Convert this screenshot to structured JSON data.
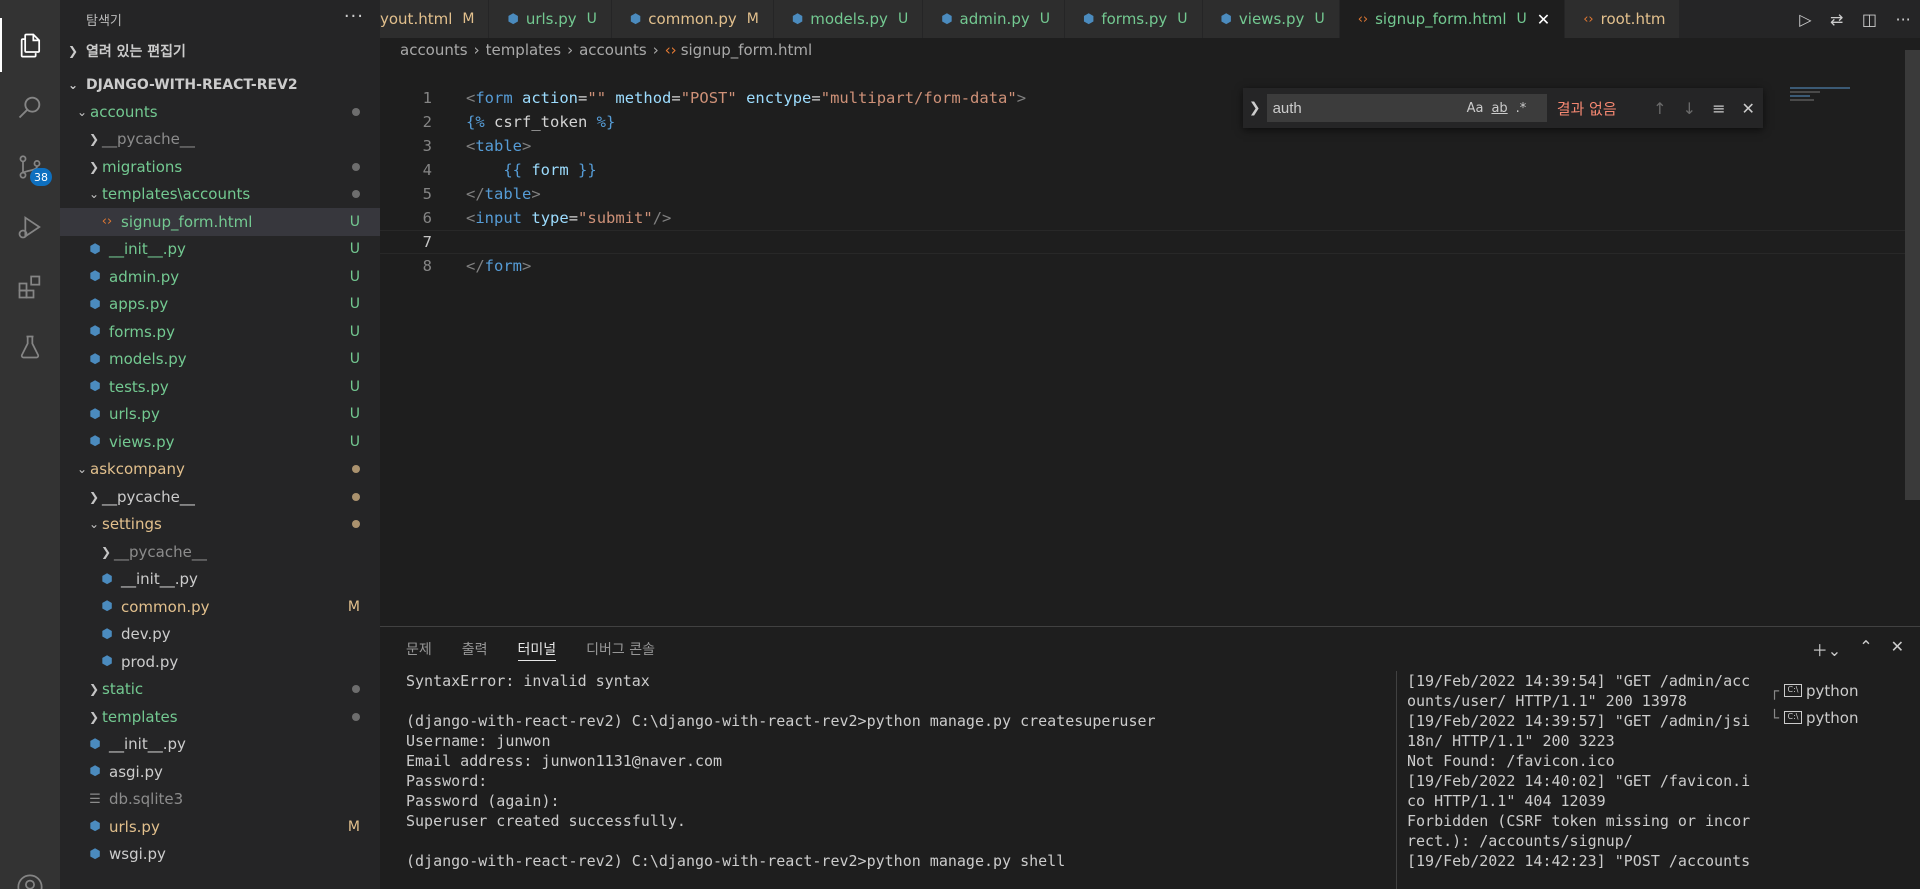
{
  "activity_bar": {
    "icons": [
      "files-icon",
      "search-icon",
      "source-control-icon",
      "run-debug-icon",
      "extensions-icon",
      "testing-icon",
      "account-icon"
    ],
    "scm_badge": "38"
  },
  "sidebar": {
    "title": "탐색기",
    "open_editors": "열려 있는 편집기",
    "project": "DJANGO-WITH-REACT-REV2",
    "tree": [
      {
        "label": "accounts",
        "type": "folder",
        "open": true,
        "depth": 1,
        "color": "green",
        "status": "dot",
        "status_color": "gray"
      },
      {
        "label": "__pycache__",
        "type": "folder",
        "open": false,
        "depth": 2,
        "color": "gray",
        "status": ""
      },
      {
        "label": "migrations",
        "type": "folder",
        "open": false,
        "depth": 2,
        "color": "green",
        "status": "dot",
        "status_color": "gray"
      },
      {
        "label": "templates\\accounts",
        "type": "folder",
        "open": true,
        "depth": 2,
        "color": "green",
        "status": "dot",
        "status_color": "gray"
      },
      {
        "label": "signup_form.html",
        "type": "html",
        "depth": 3,
        "color": "green",
        "status": "U",
        "status_color": "green",
        "selected": true
      },
      {
        "label": "__init__.py",
        "type": "py",
        "depth": 2,
        "color": "green",
        "status": "U",
        "status_color": "green"
      },
      {
        "label": "admin.py",
        "type": "py",
        "depth": 2,
        "color": "green",
        "status": "U",
        "status_color": "green"
      },
      {
        "label": "apps.py",
        "type": "py",
        "depth": 2,
        "color": "green",
        "status": "U",
        "status_color": "green"
      },
      {
        "label": "forms.py",
        "type": "py",
        "depth": 2,
        "color": "green",
        "status": "U",
        "status_color": "green"
      },
      {
        "label": "models.py",
        "type": "py",
        "depth": 2,
        "color": "green",
        "status": "U",
        "status_color": "green"
      },
      {
        "label": "tests.py",
        "type": "py",
        "depth": 2,
        "color": "green",
        "status": "U",
        "status_color": "green"
      },
      {
        "label": "urls.py",
        "type": "py",
        "depth": 2,
        "color": "green",
        "status": "U",
        "status_color": "green"
      },
      {
        "label": "views.py",
        "type": "py",
        "depth": 2,
        "color": "green",
        "status": "U",
        "status_color": "green"
      },
      {
        "label": "askcompany",
        "type": "folder",
        "open": true,
        "depth": 1,
        "color": "yellow",
        "status": "dot",
        "status_color": "yellow"
      },
      {
        "label": "__pycache__",
        "type": "folder",
        "open": false,
        "depth": 2,
        "color": "white",
        "status": "dot",
        "status_color": "yellow"
      },
      {
        "label": "settings",
        "type": "folder",
        "open": true,
        "depth": 2,
        "color": "yellow",
        "status": "dot",
        "status_color": "yellow"
      },
      {
        "label": "__pycache__",
        "type": "folder",
        "open": false,
        "depth": 3,
        "color": "gray",
        "status": ""
      },
      {
        "label": "__init__.py",
        "type": "py",
        "depth": 3,
        "color": "white",
        "status": ""
      },
      {
        "label": "common.py",
        "type": "py",
        "depth": 3,
        "color": "yellow",
        "status": "M",
        "status_color": "yellow"
      },
      {
        "label": "dev.py",
        "type": "py",
        "depth": 3,
        "color": "white",
        "status": ""
      },
      {
        "label": "prod.py",
        "type": "py",
        "depth": 3,
        "color": "white",
        "status": ""
      },
      {
        "label": "static",
        "type": "folder",
        "open": false,
        "depth": 2,
        "color": "green",
        "status": "dot",
        "status_color": "gray"
      },
      {
        "label": "templates",
        "type": "folder",
        "open": false,
        "depth": 2,
        "color": "green",
        "status": "dot",
        "status_color": "gray"
      },
      {
        "label": "__init__.py",
        "type": "py",
        "depth": 2,
        "color": "white",
        "status": ""
      },
      {
        "label": "asgi.py",
        "type": "py",
        "depth": 2,
        "color": "white",
        "status": ""
      },
      {
        "label": "db.sqlite3",
        "type": "db",
        "depth": 2,
        "color": "gray",
        "status": ""
      },
      {
        "label": "urls.py",
        "type": "py",
        "depth": 2,
        "color": "yellow",
        "status": "M",
        "status_color": "yellow"
      },
      {
        "label": "wsgi.py",
        "type": "py",
        "depth": 2,
        "color": "white",
        "status": ""
      }
    ]
  },
  "tabs": [
    {
      "label": "yout.html",
      "badge": "M",
      "icon": "none",
      "color": "yellow"
    },
    {
      "label": "urls.py",
      "badge": "U",
      "icon": "py",
      "color": "green"
    },
    {
      "label": "common.py",
      "badge": "M",
      "icon": "py",
      "color": "yellow"
    },
    {
      "label": "models.py",
      "badge": "U",
      "icon": "py",
      "color": "green"
    },
    {
      "label": "admin.py",
      "badge": "U",
      "icon": "py",
      "color": "green"
    },
    {
      "label": "forms.py",
      "badge": "U",
      "icon": "py",
      "color": "green"
    },
    {
      "label": "views.py",
      "badge": "U",
      "icon": "py",
      "color": "green"
    },
    {
      "label": "signup_form.html",
      "badge": "U",
      "icon": "html",
      "color": "green",
      "active": true
    },
    {
      "label": "root.htm",
      "badge": "",
      "icon": "html",
      "color": "yellow"
    }
  ],
  "breadcrumb": [
    "accounts",
    "templates",
    "accounts",
    "signup_form.html"
  ],
  "editor": {
    "current_line": 7,
    "lines": [
      [
        [
          "t-punct",
          "<"
        ],
        [
          "t-tag",
          "form"
        ],
        [
          "t-text",
          " "
        ],
        [
          "t-attr",
          "action"
        ],
        [
          "t-text",
          "="
        ],
        [
          "t-str",
          "\"\""
        ],
        [
          "t-text",
          " "
        ],
        [
          "t-attr",
          "method"
        ],
        [
          "t-text",
          "="
        ],
        [
          "t-str",
          "\"POST\""
        ],
        [
          "t-text",
          " "
        ],
        [
          "t-attr",
          "enctype"
        ],
        [
          "t-text",
          "="
        ],
        [
          "t-str",
          "\"multipart/form-data\""
        ],
        [
          "t-punct",
          ">"
        ]
      ],
      [
        [
          "t-tmpl",
          "{%"
        ],
        [
          "t-text",
          " csrf_token "
        ],
        [
          "t-tmpl",
          "%}"
        ]
      ],
      [
        [
          "t-punct",
          "<"
        ],
        [
          "t-tag",
          "table"
        ],
        [
          "t-punct",
          ">"
        ]
      ],
      [
        [
          "t-text",
          "    "
        ],
        [
          "t-tmpl",
          "{{"
        ],
        [
          "t-attr",
          " form "
        ],
        [
          "t-tmpl",
          "}}"
        ]
      ],
      [
        [
          "t-punct",
          "</"
        ],
        [
          "t-tag",
          "table"
        ],
        [
          "t-punct",
          ">"
        ]
      ],
      [
        [
          "t-punct",
          "<"
        ],
        [
          "t-tag",
          "input"
        ],
        [
          "t-text",
          " "
        ],
        [
          "t-attr",
          "type"
        ],
        [
          "t-text",
          "="
        ],
        [
          "t-str",
          "\"submit\""
        ],
        [
          "t-punct",
          "/>"
        ]
      ],
      [],
      [
        [
          "t-punct",
          "</"
        ],
        [
          "t-tag",
          "form"
        ],
        [
          "t-punct",
          ">"
        ]
      ]
    ]
  },
  "find": {
    "query": "auth",
    "opt_case": "Aa",
    "opt_word": "ab",
    "opt_regex": ".*",
    "result": "결과 없음"
  },
  "panel": {
    "tabs": [
      "문제",
      "출력",
      "터미널",
      "디버그 콘솔"
    ],
    "active_tab": 2,
    "terminal_left": "SyntaxError: invalid syntax\n\n(django-with-react-rev2) C:\\django-with-react-rev2>python manage.py createsuperuser\nUsername: junwon\nEmail address: junwon1131@naver.com\nPassword:\nPassword (again):\nSuperuser created successfully.\n\n(django-with-react-rev2) C:\\django-with-react-rev2>python manage.py shell",
    "terminal_right": "[19/Feb/2022 14:39:54] \"GET /admin/acc\nounts/user/ HTTP/1.1\" 200 13978\n[19/Feb/2022 14:39:57] \"GET /admin/jsi\n18n/ HTTP/1.1\" 200 3223\nNot Found: /favicon.ico\n[19/Feb/2022 14:40:02] \"GET /favicon.i\nco HTTP/1.1\" 404 12039\nForbidden (CSRF token missing or incor\nrect.): /accounts/signup/\n[19/Feb/2022 14:42:23] \"POST /accounts",
    "terminals": [
      "python",
      "python"
    ],
    "term_icon_text": "C:\\"
  },
  "colors": {
    "green": "#73c991",
    "yellow": "#e2c08d",
    "gray": "#8c8c8c",
    "white": "#cccccc",
    "accent": "#0e70c0"
  }
}
